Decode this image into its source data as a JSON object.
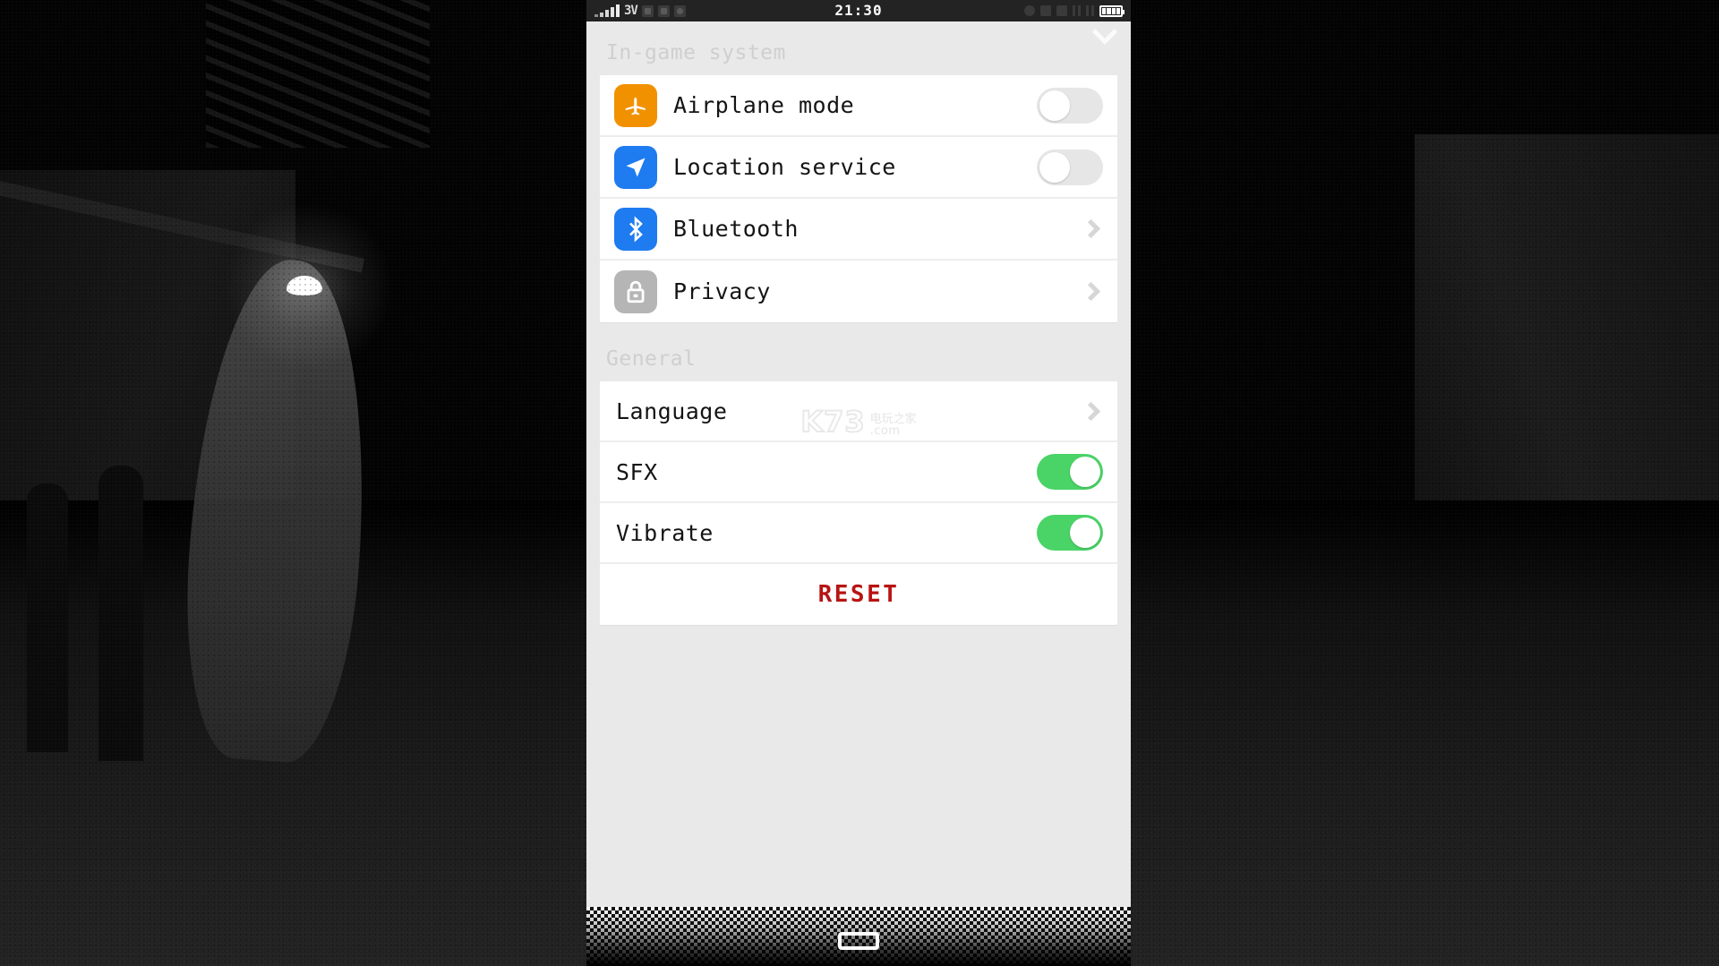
{
  "statusbar": {
    "network_label": "3V",
    "time": "21:30",
    "signal_icon": "signal-bars-icon",
    "battery_icon": "battery-full-icon",
    "left_icons": [
      "bluetooth-small-icon",
      "plus-small-icon",
      "camera-small-icon"
    ],
    "right_icons": [
      "circle-icon",
      "alarm-icon",
      "antenna-icon",
      "pause-bars-icon",
      "pause-bars-icon-2"
    ]
  },
  "panel": {
    "collapse_icon": "chevron-down-icon"
  },
  "sections": [
    {
      "title": "In-game system",
      "rows": [
        {
          "label": "Airplane mode",
          "icon": "airplane-icon",
          "icon_color": "#f29100",
          "control": "toggle",
          "state": "off"
        },
        {
          "label": "Location service",
          "icon": "location-icon",
          "icon_color": "#1e7bf0",
          "control": "toggle",
          "state": "off"
        },
        {
          "label": "Bluetooth",
          "icon": "bluetooth-icon",
          "icon_color": "#1e7bf0",
          "control": "chevron"
        },
        {
          "label": "Privacy",
          "icon": "lock-icon",
          "icon_color": "#b5b5b5",
          "control": "chevron"
        }
      ]
    },
    {
      "title": "General",
      "rows": [
        {
          "label": "Language",
          "control": "chevron"
        },
        {
          "label": "SFX",
          "control": "toggle",
          "state": "on"
        },
        {
          "label": "Vibrate",
          "control": "toggle",
          "state": "on"
        }
      ],
      "reset_label": "RESET"
    }
  ],
  "watermark": {
    "logo": "K73",
    "cn": "电玩之家",
    "domain": ".com"
  },
  "colors": {
    "toggle_on": "#4ad367",
    "toggle_off": "#e6e6e6",
    "reset_red": "#b81414",
    "panel_bg": "#e9e9e9",
    "card_bg": "#ffffff"
  }
}
